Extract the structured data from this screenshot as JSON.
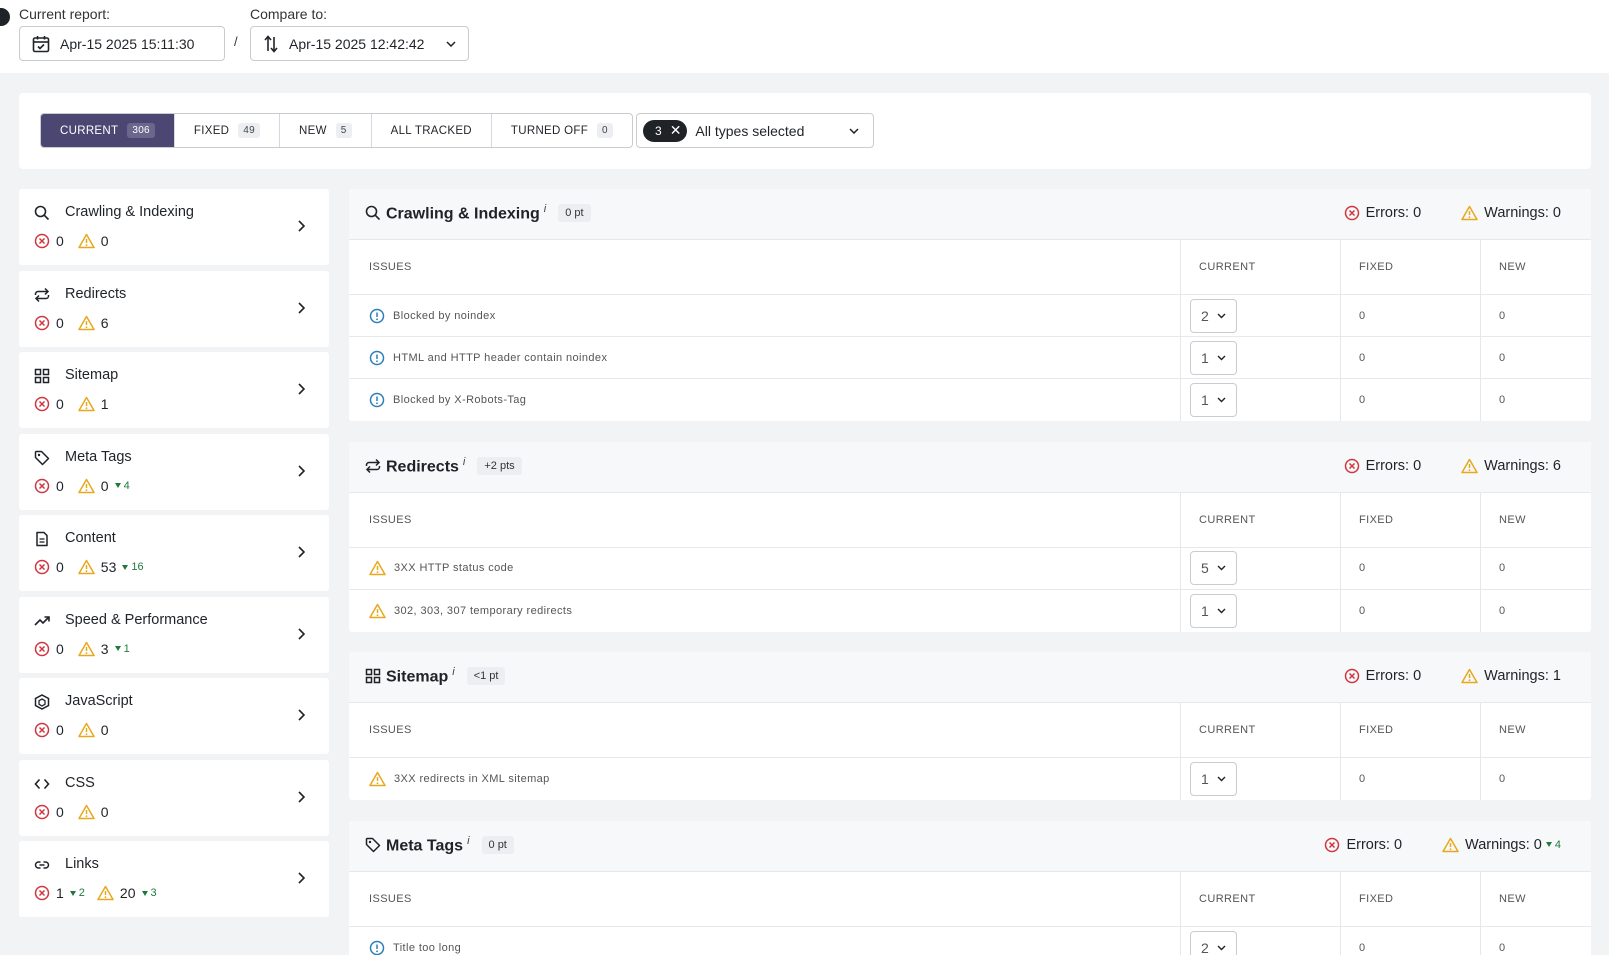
{
  "header": {
    "current_label": "Current report:",
    "current_value": "Apr-15 2025 15:11:30",
    "separator": "/",
    "compare_label": "Compare to:",
    "compare_value": "Apr-15 2025 12:42:42"
  },
  "filters": {
    "tabs": [
      {
        "label": "CURRENT",
        "count": "306"
      },
      {
        "label": "FIXED",
        "count": "49"
      },
      {
        "label": "NEW",
        "count": "5"
      },
      {
        "label": "ALL TRACKED",
        "count": ""
      },
      {
        "label": "TURNED OFF",
        "count": "0"
      }
    ],
    "types_count": "3",
    "types_label": "All types selected"
  },
  "sidebar": {
    "items": [
      {
        "label": "Crawling & Indexing",
        "icon": "search-icon",
        "errors": "0",
        "warnings": "0",
        "errors_delta": "",
        "warnings_delta": ""
      },
      {
        "label": "Redirects",
        "icon": "redirect-icon",
        "errors": "0",
        "warnings": "6",
        "errors_delta": "",
        "warnings_delta": ""
      },
      {
        "label": "Sitemap",
        "icon": "grid-icon",
        "errors": "0",
        "warnings": "1",
        "errors_delta": "",
        "warnings_delta": ""
      },
      {
        "label": "Meta Tags",
        "icon": "tag-icon",
        "errors": "0",
        "warnings": "0",
        "errors_delta": "",
        "warnings_delta": "4"
      },
      {
        "label": "Content",
        "icon": "document-icon",
        "errors": "0",
        "warnings": "53",
        "errors_delta": "",
        "warnings_delta": "16"
      },
      {
        "label": "Speed & Performance",
        "icon": "trending-icon",
        "errors": "0",
        "warnings": "3",
        "errors_delta": "",
        "warnings_delta": "1"
      },
      {
        "label": "JavaScript",
        "icon": "js-icon",
        "errors": "0",
        "warnings": "0",
        "errors_delta": "",
        "warnings_delta": ""
      },
      {
        "label": "CSS",
        "icon": "code-icon",
        "errors": "0",
        "warnings": "0",
        "errors_delta": "",
        "warnings_delta": ""
      },
      {
        "label": "Links",
        "icon": "link-icon",
        "errors": "1",
        "warnings": "20",
        "errors_delta": "2",
        "warnings_delta": "3"
      }
    ]
  },
  "table_headers": {
    "issues": "ISSUES",
    "current": "CURRENT",
    "fixed": "FIXED",
    "new": "NEW"
  },
  "sections": [
    {
      "title": "Crawling & Indexing",
      "info": "i",
      "points": "0 pt",
      "errors_label": "Errors: 0",
      "warnings_label": "Warnings: 0",
      "warnings_delta": "",
      "rows": [
        {
          "type": "notice",
          "issue": "Blocked by noindex",
          "current": "2",
          "fixed": "0",
          "new": "0"
        },
        {
          "type": "notice",
          "issue": "HTML and HTTP header contain noindex",
          "current": "1",
          "fixed": "0",
          "new": "0"
        },
        {
          "type": "notice",
          "issue": "Blocked by X-Robots-Tag",
          "current": "1",
          "fixed": "0",
          "new": "0"
        }
      ]
    },
    {
      "title": "Redirects",
      "info": "i",
      "points": "+2 pts",
      "errors_label": "Errors: 0",
      "warnings_label": "Warnings: 6",
      "warnings_delta": "",
      "rows": [
        {
          "type": "warning",
          "issue": "3XX HTTP status code",
          "current": "5",
          "fixed": "0",
          "new": "0"
        },
        {
          "type": "warning",
          "issue": "302, 303, 307 temporary redirects",
          "current": "1",
          "fixed": "0",
          "new": "0"
        }
      ]
    },
    {
      "title": "Sitemap",
      "info": "i",
      "points": "<1 pt",
      "errors_label": "Errors: 0",
      "warnings_label": "Warnings: 1",
      "warnings_delta": "",
      "rows": [
        {
          "type": "warning",
          "issue": "3XX redirects in XML sitemap",
          "current": "1",
          "fixed": "0",
          "new": "0"
        }
      ]
    },
    {
      "title": "Meta Tags",
      "info": "i",
      "points": "0 pt",
      "errors_label": "Errors: 0",
      "warnings_label": "Warnings: 0",
      "warnings_delta": "4",
      "rows": [
        {
          "type": "notice",
          "issue": "Title too long",
          "current": "2",
          "fixed": "0",
          "new": "0"
        }
      ]
    }
  ],
  "colors": {
    "accent": "#4b4772",
    "error": "#d1363f",
    "warning": "#e7a81d",
    "notice": "#2c7fb8",
    "positive": "#1e7a3c"
  }
}
